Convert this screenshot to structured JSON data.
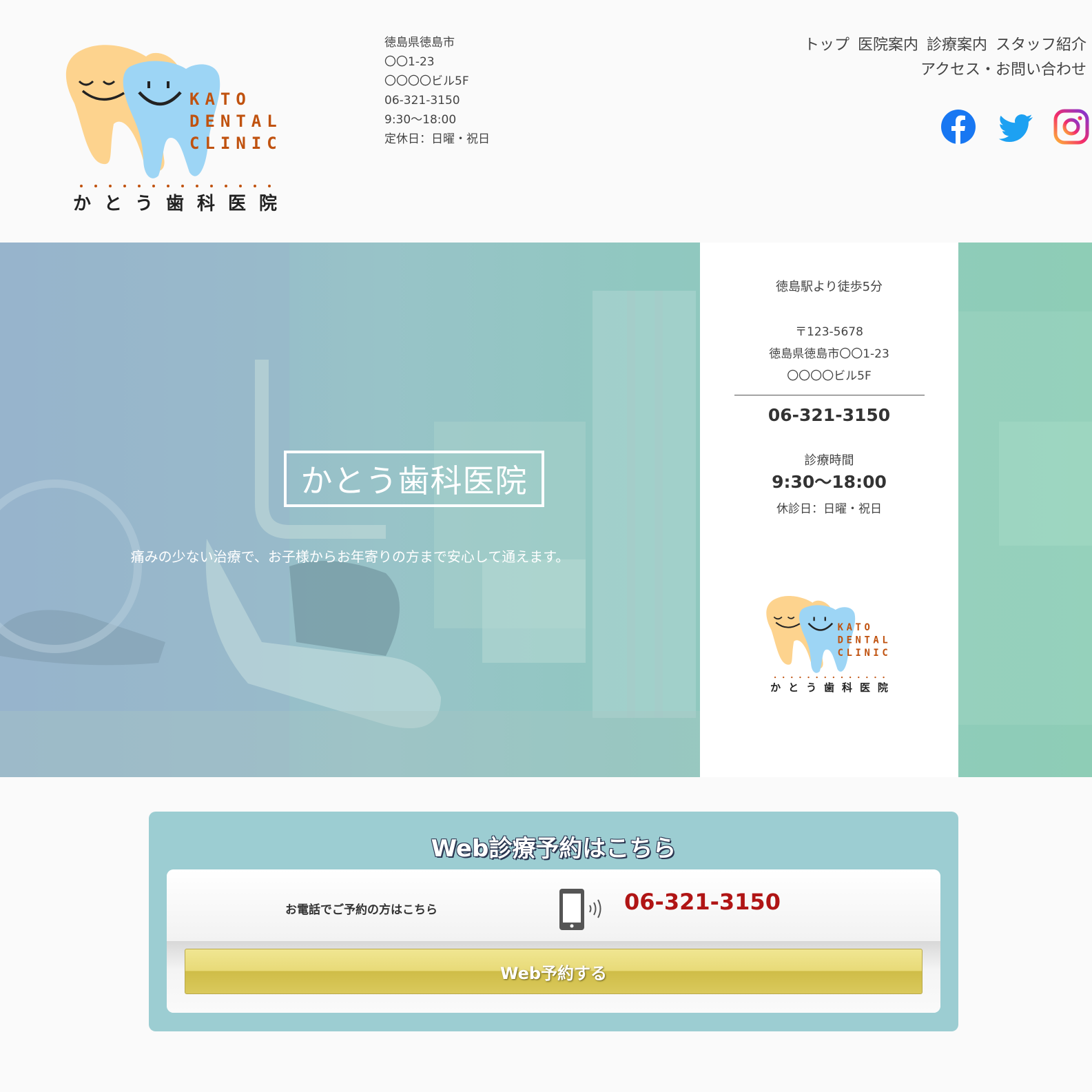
{
  "header": {
    "logo": {
      "en_line1": "KATO",
      "en_line2": "DENTAL",
      "en_line3": "CLINIC",
      "jp": "かとう歯科医院"
    },
    "address_lines": [
      "徳島県徳島市",
      "〇〇1-23",
      "〇〇〇〇ビル5F",
      "06-321-3150",
      "9:30〜18:00",
      "定休日：日曜・祝日"
    ],
    "nav_row1": [
      "トップ",
      "医院案内",
      "診療案内",
      "スタッフ紹介"
    ],
    "nav_row2": [
      "アクセス・お問い合わせ"
    ],
    "social": [
      "facebook-icon",
      "twitter-icon",
      "instagram-icon"
    ]
  },
  "hero": {
    "title": "かとう歯科医院",
    "subtitle": "痛みの少ない治療で、お子様からお年寄りの方まで安心して通えます。"
  },
  "info": {
    "station": "徳島駅より徒歩5分",
    "postal": "〒123-5678",
    "address1": "徳島県徳島市〇〇1-23",
    "address2": "〇〇〇〇ビル5F",
    "phone": "06-321-3150",
    "hours_label": "診療時間",
    "hours": "9:30〜18:00",
    "closed": "休診日：日曜・祝日"
  },
  "reserve": {
    "title": "Web診療予約はこちら",
    "phone_label": "お電話でご予約の方はこちら",
    "phone": "06-321-3150",
    "button": "Web予約する"
  },
  "colors": {
    "accent": "#9ccdd2",
    "phone_red": "#b01515",
    "tooth_orange": "#fdd38e",
    "tooth_blue": "#9dd5f5",
    "logo_text": "#c0520f",
    "button_gold": "#e0d068"
  }
}
